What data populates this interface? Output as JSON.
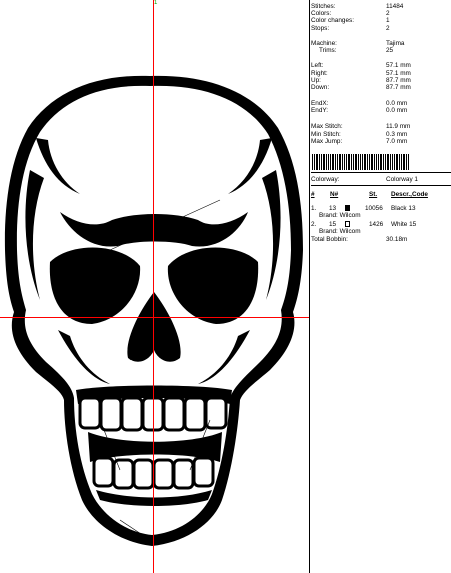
{
  "canvas": {
    "accent_color": "#ff0000",
    "marker": "1",
    "design": "skull-embroidery"
  },
  "info": {
    "stitches_label": "Stitches:",
    "stitches": "11484",
    "colors_label": "Colors:",
    "colors": "2",
    "color_changes_label": "Color changes:",
    "color_changes": "1",
    "stops_label": "Stops:",
    "stops": "2",
    "machine_label": "Machine:",
    "machine": "Tajima",
    "trims_label": "Trims:",
    "trims": "25",
    "left_label": "Left:",
    "left": "57.1 mm",
    "right_label": "Right:",
    "right": "57.1 mm",
    "up_label": "Up:",
    "up": "87.7 mm",
    "down_label": "Down:",
    "down": "87.7 mm",
    "endx_label": "EndX:",
    "endx": "0.0 mm",
    "endy_label": "EndY:",
    "endy": "0.0 mm",
    "max_stitch_label": "Max Stitch:",
    "max_stitch": "11.9 mm",
    "min_stitch_label": "Min Stitch:",
    "min_stitch": "0.3 mm",
    "max_jump_label": "Max Jump:",
    "max_jump": "7.0 mm"
  },
  "colorway": {
    "label": "Colorway:",
    "value": "Colorway 1"
  },
  "table": {
    "headers": [
      "#",
      "N#",
      "St.",
      "Descr.,Code"
    ],
    "rows": [
      {
        "index": "1.",
        "n": "13",
        "swatch": "#000000",
        "stitches": "10056",
        "descr": "Black 13",
        "brand": "Brand: Wilcom"
      },
      {
        "index": "2.",
        "n": "15",
        "swatch": "#ffffff",
        "stitches": "1426",
        "descr": "White 15",
        "brand": "Brand: Wilcom"
      }
    ],
    "total_bobbin_label": "Total Bobbin:",
    "total_bobbin": "30.18m"
  }
}
